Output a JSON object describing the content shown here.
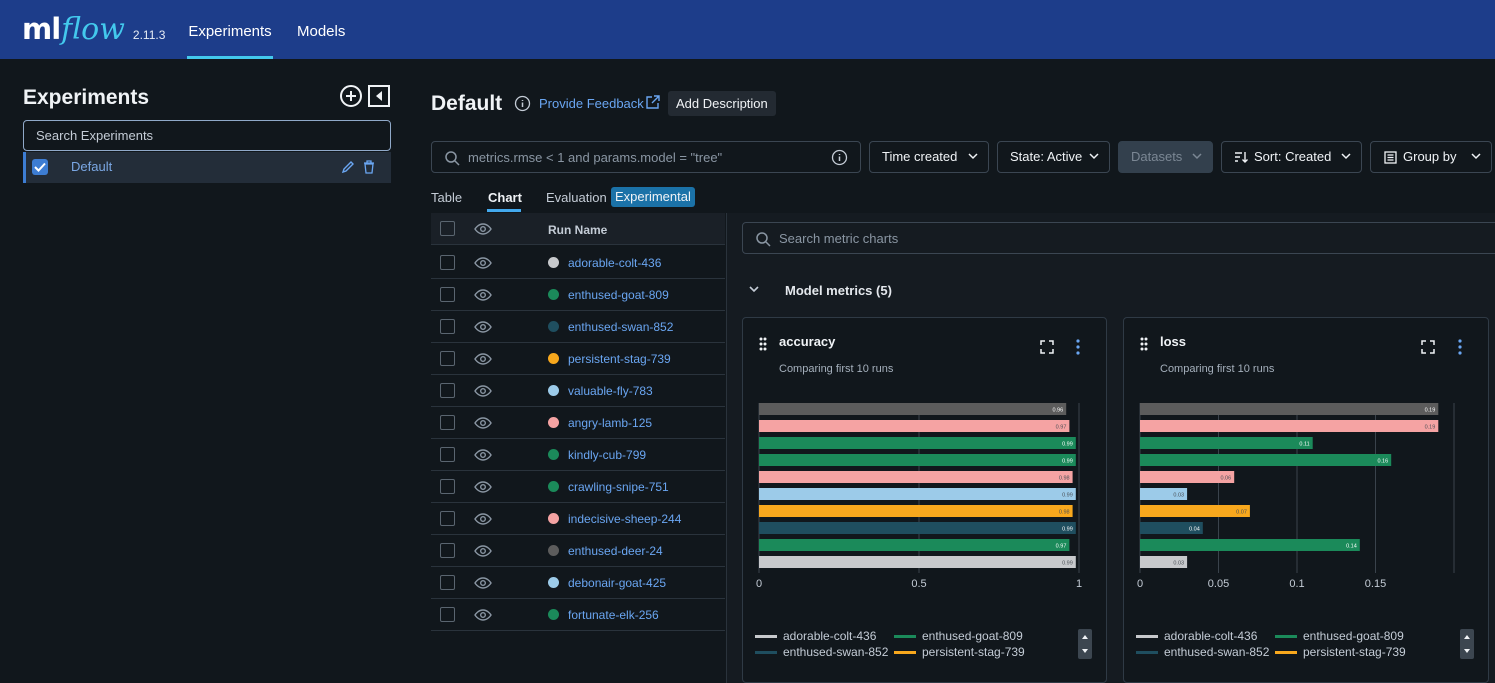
{
  "app": {
    "logo_ml": "ml",
    "logo_flow": "flow",
    "version": "2.11.3",
    "nav": [
      {
        "label": "Experiments",
        "active": true
      },
      {
        "label": "Models",
        "active": false
      }
    ],
    "accent": "#43c9ed",
    "header_bg": "#1d3d8a"
  },
  "sidebar": {
    "title": "Experiments",
    "search_placeholder": "Search Experiments",
    "experiments": [
      {
        "name": "Default",
        "checked": true
      }
    ]
  },
  "main": {
    "title": "Default",
    "feedback": "Provide Feedback",
    "add_description": "Add Description",
    "filter_placeholder": "metrics.rmse < 1 and params.model = \"tree\"",
    "buttons": {
      "time_created": "Time created",
      "state": "State: Active",
      "datasets": "Datasets",
      "sort": "Sort: Created",
      "group_by": "Group by"
    },
    "tabs": [
      "Table",
      "Chart",
      "Evaluation"
    ],
    "active_tab": "Chart",
    "experimental_badge": "Experimental",
    "table_header": "Run Name",
    "runs": [
      {
        "name": "adorable-colt-436",
        "color": "#c7c9cc"
      },
      {
        "name": "enthused-goat-809",
        "color": "#1b8a5a"
      },
      {
        "name": "enthused-swan-852",
        "color": "#1f4e5f"
      },
      {
        "name": "persistent-stag-739",
        "color": "#f8a81d"
      },
      {
        "name": "valuable-fly-783",
        "color": "#9ccbe9"
      },
      {
        "name": "angry-lamb-125",
        "color": "#f5a3a3"
      },
      {
        "name": "kindly-cub-799",
        "color": "#1b8a5a"
      },
      {
        "name": "crawling-snipe-751",
        "color": "#1b8a5a"
      },
      {
        "name": "indecisive-sheep-244",
        "color": "#f5a3a3"
      },
      {
        "name": "enthused-deer-24",
        "color": "#5c5c5c"
      },
      {
        "name": "debonair-goat-425",
        "color": "#9ccbe9"
      },
      {
        "name": "fortunate-elk-256",
        "color": "#1b8a5a"
      }
    ]
  },
  "charts_panel": {
    "search_placeholder": "Search metric charts",
    "section_title": "Model metrics (5)",
    "cards": [
      {
        "title": "accuracy",
        "subtitle": "Comparing first 10 runs"
      },
      {
        "title": "loss",
        "subtitle": "Comparing first 10 runs"
      }
    ],
    "legend": [
      {
        "name": "adorable-colt-436",
        "color": "#c7c9cc"
      },
      {
        "name": "enthused-goat-809",
        "color": "#1b8a5a"
      },
      {
        "name": "enthused-swan-852",
        "color": "#1f4e5f"
      },
      {
        "name": "persistent-stag-739",
        "color": "#f8a81d"
      }
    ]
  },
  "chart_data": [
    {
      "type": "bar",
      "orientation": "horizontal",
      "title": "accuracy",
      "xlim": [
        0,
        1
      ],
      "ticks": [
        "0",
        "0.5",
        "1"
      ],
      "bars": [
        {
          "value": 0.96,
          "label": "0.96",
          "color": "#5c5c5c"
        },
        {
          "value": 0.97,
          "label": "0.97",
          "color": "#f5a3a3"
        },
        {
          "value": 0.99,
          "label": "0.99",
          "color": "#1b8a5a"
        },
        {
          "value": 0.99,
          "label": "0.99",
          "color": "#1b8a5a"
        },
        {
          "value": 0.98,
          "label": "0.98",
          "color": "#f5a3a3"
        },
        {
          "value": 0.99,
          "label": "0.99",
          "color": "#9ccbe9"
        },
        {
          "value": 0.98,
          "label": "0.98",
          "color": "#f8a81d"
        },
        {
          "value": 0.99,
          "label": "0.99",
          "color": "#1f4e5f"
        },
        {
          "value": 0.97,
          "label": "0.97",
          "color": "#1b8a5a"
        },
        {
          "value": 0.99,
          "label": "0.99",
          "color": "#c7c9cc"
        }
      ]
    },
    {
      "type": "bar",
      "orientation": "horizontal",
      "title": "loss",
      "xlim": [
        0,
        0.2
      ],
      "ticks": [
        "0",
        "0.05",
        "0.1",
        "0.15"
      ],
      "bars": [
        {
          "value": 0.19,
          "label": "0.19",
          "color": "#5c5c5c"
        },
        {
          "value": 0.19,
          "label": "0.19",
          "color": "#f5a3a3"
        },
        {
          "value": 0.11,
          "label": "0.11",
          "color": "#1b8a5a"
        },
        {
          "value": 0.16,
          "label": "0.16",
          "color": "#1b8a5a"
        },
        {
          "value": 0.06,
          "label": "0.06",
          "color": "#f5a3a3"
        },
        {
          "value": 0.03,
          "label": "0.03",
          "color": "#9ccbe9"
        },
        {
          "value": 0.07,
          "label": "0.07",
          "color": "#f8a81d"
        },
        {
          "value": 0.04,
          "label": "0.04",
          "color": "#1f4e5f"
        },
        {
          "value": 0.14,
          "label": "0.14",
          "color": "#1b8a5a"
        },
        {
          "value": 0.03,
          "label": "0.03",
          "color": "#c7c9cc"
        }
      ]
    }
  ]
}
